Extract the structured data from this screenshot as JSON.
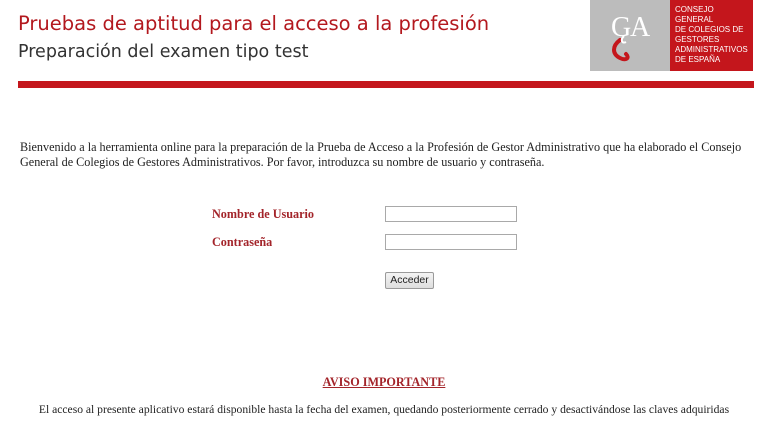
{
  "header": {
    "title": "Pruebas de aptitud para el acceso a la profesión",
    "subtitle": "Preparación del examen tipo test"
  },
  "logo": {
    "lines": [
      "CONSEJO GENERAL",
      "DE COLEGIOS DE",
      "GESTORES",
      "ADMINISTRATIVOS",
      "DE ESPAÑA"
    ],
    "mark_colors": {
      "background": "#bcbcbc",
      "ga": "#ffffff",
      "swoosh": "#c4161c"
    },
    "accent": "#c4161c"
  },
  "intro_text": "Bienvenido a la herramienta online para la preparación de la Prueba de Acceso a la Profesión de Gestor Administrativo que ha elaborado el Consejo General de Colegios de Gestores Administrativos. Por favor, introduzca su nombre de usuario y contraseña.",
  "form": {
    "username_label": "Nombre de Usuario",
    "username_value": "",
    "password_label": "Contraseña",
    "password_value": "",
    "submit_label": "Acceder"
  },
  "notice": {
    "title": "AVISO IMPORTANTE",
    "body": "El acceso al presente aplicativo estará disponible hasta la fecha del examen, quedando posteriormente cerrado y desactivándose las claves adquiridas"
  }
}
